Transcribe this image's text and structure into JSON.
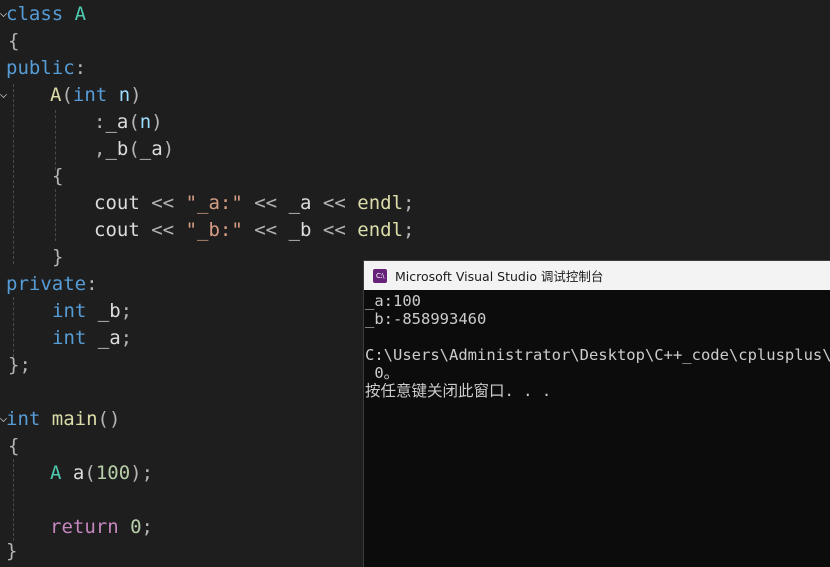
{
  "editor": {
    "lines": {
      "l1": {
        "kw": "class",
        "cls": "A"
      },
      "l2": {
        "brace": "{"
      },
      "l3": {
        "kw": "public",
        "colon": ":"
      },
      "l4": {
        "name": "A",
        "open": "(",
        "type": "int",
        "param": "n",
        "close": ")"
      },
      "l5": {
        "colon": ":",
        "member": "_a",
        "open": "(",
        "arg": "n",
        "close": ")"
      },
      "l6": {
        "comma": ",",
        "member": "_b",
        "open": "(",
        "arg": "_a",
        "close": ")"
      },
      "l7": {
        "brace": "{"
      },
      "l8": {
        "obj": "cout",
        "op1": "<<",
        "str": "\"_a:\"",
        "op2": "<<",
        "var": "_a",
        "op3": "<<",
        "end": "endl",
        "semi": ";"
      },
      "l9": {
        "obj": "cout",
        "op1": "<<",
        "str": "\"_b:\"",
        "op2": "<<",
        "var": "_b",
        "op3": "<<",
        "end": "endl",
        "semi": ";"
      },
      "l10": {
        "brace": "}"
      },
      "l11": {
        "kw": "private",
        "colon": ":"
      },
      "l12": {
        "type": "int",
        "name": "_b",
        "semi": ";"
      },
      "l13": {
        "type": "int",
        "name": "_a",
        "semi": ";"
      },
      "l14": {
        "brace": "};"
      },
      "l15": {
        "type": "int",
        "name": "main",
        "parens": "()"
      },
      "l16": {
        "brace": "{"
      },
      "l17": {
        "cls": "A",
        "name": "a",
        "open": "(",
        "num": "100",
        "close": ");"
      },
      "l18": {
        "kw": "return",
        "num": "0",
        "semi": ";"
      },
      "l19": {
        "brace": "}"
      }
    }
  },
  "console": {
    "title": "Microsoft Visual Studio 调试控制台",
    "icon_label": "C:\\",
    "icon": "visual-studio-console-icon",
    "output": [
      "_a:100",
      "_b:-858993460",
      "",
      "C:\\Users\\Administrator\\Desktop\\C++_code\\cplusplus\\类",
      " 0。",
      "按任意键关闭此窗口. . ."
    ]
  },
  "colors": {
    "keyword": "#569cd6",
    "type": "#4ec9b0",
    "function": "#dcdcaa",
    "string": "#d69d85",
    "number": "#b5cea8",
    "background": "#1e1e1e",
    "console_background": "#0c0c0c"
  }
}
